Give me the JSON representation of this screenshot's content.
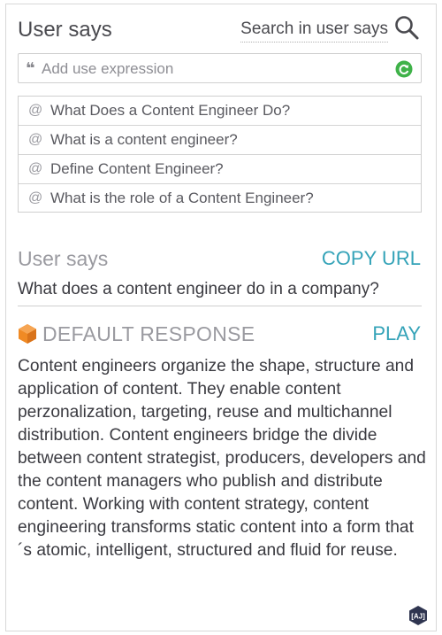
{
  "header": {
    "title": "User says",
    "search_label": "Search in user says"
  },
  "expression_input": {
    "placeholder": "Add use expression"
  },
  "expressions": [
    {
      "text": "What Does a Content Engineer Do?"
    },
    {
      "text": "What is a content engineer?"
    },
    {
      "text": "Define Content Engineer?"
    },
    {
      "text": "What is the role of a Content Engineer?"
    }
  ],
  "user_says": {
    "label": "User says",
    "copy_url_label": "COPY URL",
    "value": "What does a content engineer do in a company?"
  },
  "response": {
    "title": "DEFAULT RESPONSE",
    "play_label": "PLAY",
    "text": "Content engineers organize the shape, structure and application of content. They enable content perzonalization, targeting, reuse and multichannel distribution. Content engineers bridge the divide between content strategist, producers, developers and the content managers who publish and distribute content. Working with content strategy, content engineering transforms static content into a form that´s atomic, intelligent, structured and fluid for reuse."
  },
  "icons": {
    "search": "search-icon",
    "quote": "quote-icon",
    "refresh": "refresh-icon",
    "at": "at-icon",
    "response": "hexagon-icon",
    "badge": "aj-badge-icon"
  },
  "colors": {
    "accent": "#34a3b8",
    "refresh_green": "#3fb249",
    "response_icon": "#f08a24"
  }
}
